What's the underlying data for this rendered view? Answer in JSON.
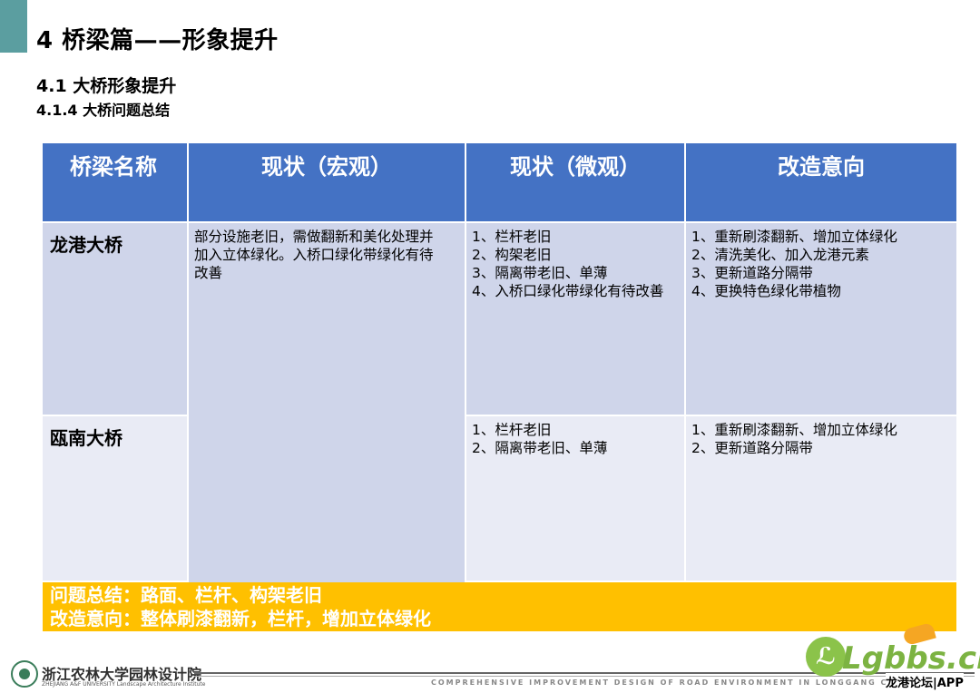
{
  "header": {
    "title": "4 桥梁篇——形象提升",
    "section": "4.1 大桥形象提升",
    "subsection": "4.1.4 大桥问题总结"
  },
  "table": {
    "columns": [
      "桥梁名称",
      "现状（宏观）",
      "现状（微观）",
      "改造意向"
    ],
    "macro_shared": "部分设施老旧，需做翻新和美化处理并\n加入立体绿化。入桥口绿化带绿化有待\n改善",
    "rows": [
      {
        "name": "龙港大桥",
        "micro": "1、栏杆老旧\n2、构架老旧\n3、隔离带老旧、单薄\n4、入桥口绿化带绿化有待改善",
        "intent": "1、重新刷漆翻新、增加立体绿化\n2、清洗美化、加入龙港元素\n3、更新道路分隔带\n4、更换特色绿化带植物"
      },
      {
        "name": "瓯南大桥",
        "micro": "1、栏杆老旧\n2、隔离带老旧、单薄",
        "intent": "1、重新刷漆翻新、增加立体绿化\n2、更新道路分隔带"
      }
    ]
  },
  "summary": {
    "line1": "问题总结：路面、栏杆、构架老旧",
    "line2": "改造意向：整体刷漆翻新，栏杆，增加立体绿化"
  },
  "footer": {
    "logo_cn": "浙江农林大学园林设计院",
    "logo_en": "ZHEJIANG A&F UNIVERSITY Landscape Architecture Institute",
    "english_title": "COMPREHENSIVE IMPROVEMENT DESIGN OF ROAD ENVIRONMENT IN LONGGANG CITY"
  },
  "watermark": {
    "text": "Lgbbs.cn",
    "sub": "龙港论坛|APP"
  },
  "colors": {
    "accent": "#5b9ea0",
    "header_blue": "#4472c4",
    "row_dark": "#cfd5ea",
    "row_light": "#e9ebf5",
    "summary_yellow": "#ffc000"
  }
}
